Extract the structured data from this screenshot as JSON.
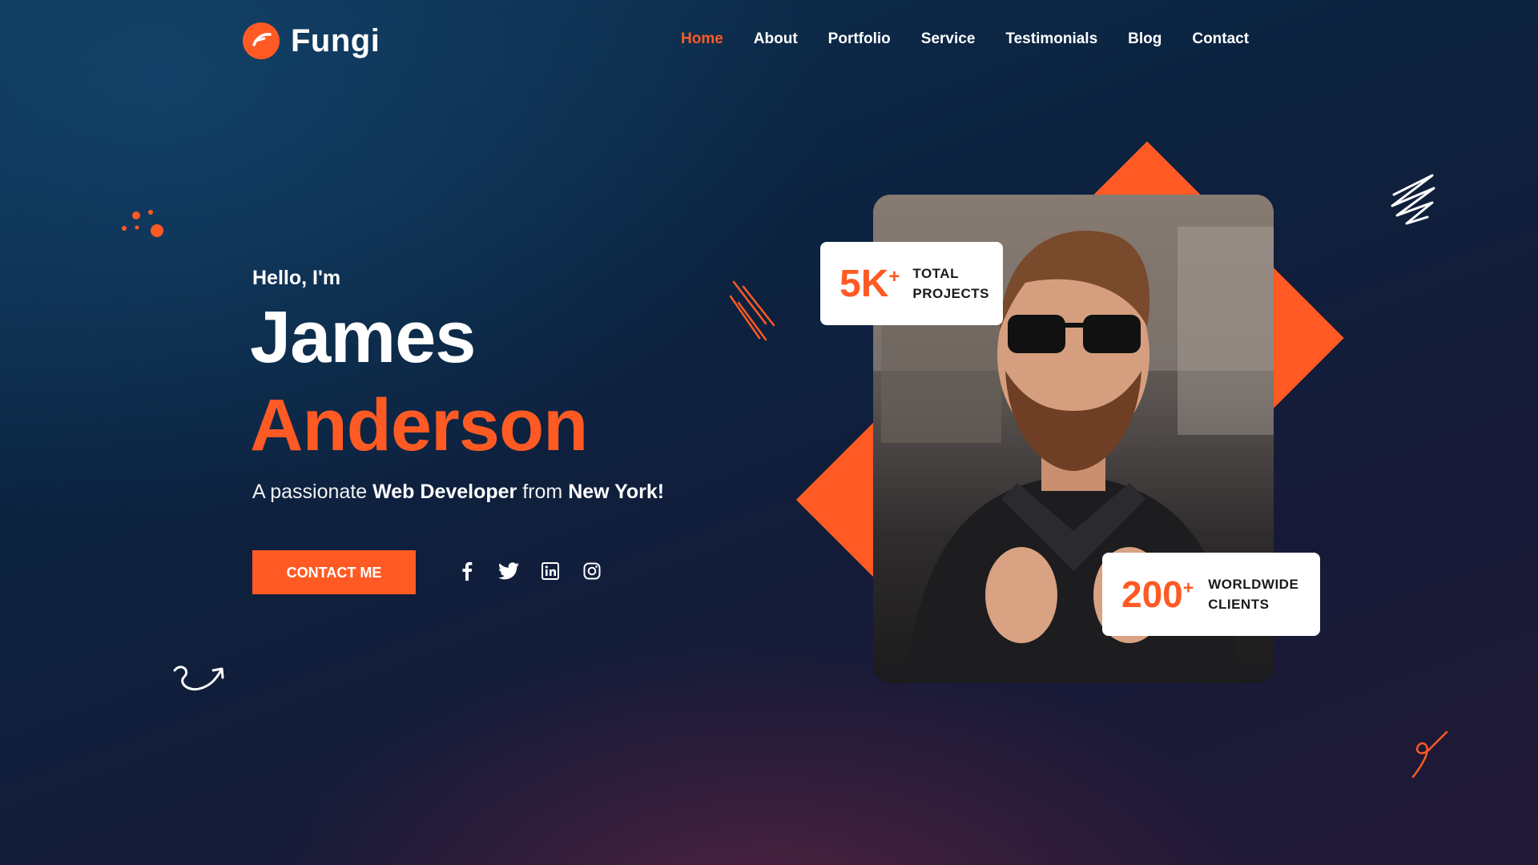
{
  "brand": {
    "name": "Fungi",
    "accent": "#ff5a24"
  },
  "nav": [
    {
      "label": "Home",
      "active": true
    },
    {
      "label": "About"
    },
    {
      "label": "Portfolio"
    },
    {
      "label": "Service"
    },
    {
      "label": "Testimonials"
    },
    {
      "label": "Blog"
    },
    {
      "label": "Contact"
    }
  ],
  "hero": {
    "greeting": "Hello, I'm",
    "first_name": "James",
    "last_name": "Anderson",
    "tagline_pre": "A passionate ",
    "tagline_role": "Web Developer",
    "tagline_mid": " from ",
    "tagline_place": "New York!",
    "cta_label": "CONTACT ME",
    "social_icons": [
      "facebook-icon",
      "twitter-icon",
      "linkedin-icon",
      "instagram-icon"
    ]
  },
  "stats": {
    "projects": {
      "value": "5K",
      "suffix": "+",
      "line1": "TOTAL",
      "line2": "PROJECTS"
    },
    "clients": {
      "value": "200",
      "suffix": "+",
      "line1": "WORLDWIDE",
      "line2": "CLIENTS"
    }
  }
}
